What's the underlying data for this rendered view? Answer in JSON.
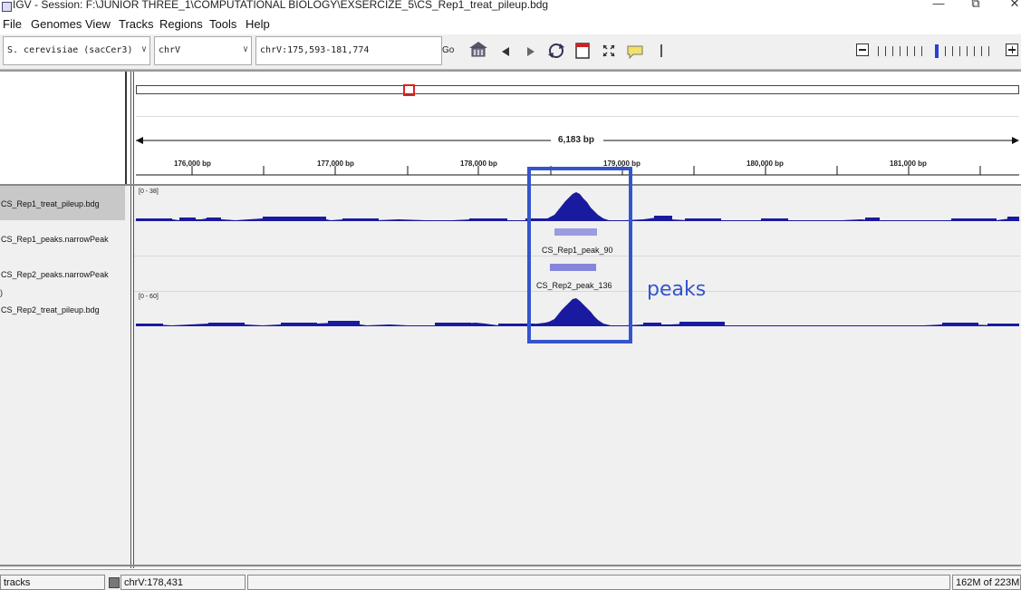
{
  "window": {
    "title": "IGV - Session: F:\\JUNIOR THREE_1\\COMPUTATIONAL BIOLOGY\\EXSERCIZE_5\\CS_Rep1_treat_pileup.bdg",
    "minimize": "—",
    "restore": "⧉",
    "close": "✕"
  },
  "menu": [
    "File",
    "Genomes",
    "View",
    "Tracks",
    "Regions",
    "Tools",
    "Help"
  ],
  "toolbar": {
    "genome": "S. cerevisiae (sacCer3)",
    "chromosome": "chrV",
    "locus": "chrV:175,593-181,774",
    "go_label": "Go"
  },
  "ruler": {
    "span_label": "6,183 bp",
    "ticks": [
      "176,000 bp",
      "177,000 bp",
      "178,000 bp",
      "179,000 bp",
      "180,000 bp",
      "181,000 bp"
    ]
  },
  "tracks": [
    {
      "name": "CS_Rep1_treat_pileup.bdg",
      "range": "[0 - 38]"
    },
    {
      "name": "CS_Rep1_peaks.narrowPeak",
      "feature_label": "CS_Rep1_peak_90"
    },
    {
      "name": "CS_Rep2_peaks.narrowPeak",
      "feature_label": "CS_Rep2_peak_136"
    },
    {
      "name": "CS_Rep2_treat_pileup.bdg",
      "range": "[0 - 60]"
    }
  ],
  "annotation": {
    "text": "peaks",
    "color": "#3355cc"
  },
  "colors": {
    "signal": "#1a1aa0",
    "peak_feature": "#8888dd",
    "highlight": "#3355cc"
  },
  "status": {
    "tracks_label": "tracks",
    "position": "chrV:178,431",
    "memory": "162M of 223M"
  }
}
